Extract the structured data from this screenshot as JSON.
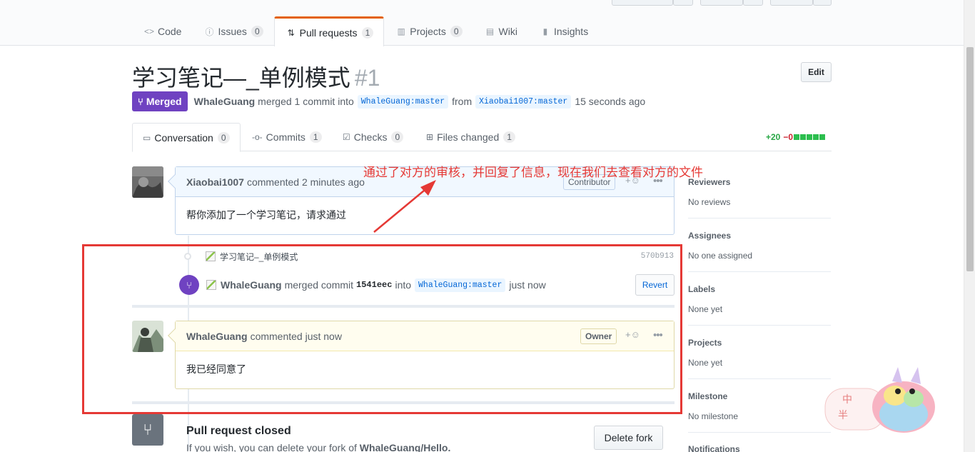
{
  "repo_nav": {
    "tabs": [
      {
        "label": "Code",
        "icon": "code-icon",
        "count": null
      },
      {
        "label": "Issues",
        "icon": "issue-icon",
        "count": "0"
      },
      {
        "label": "Pull requests",
        "icon": "pull-request-icon",
        "count": "1"
      },
      {
        "label": "Projects",
        "icon": "project-icon",
        "count": "0"
      },
      {
        "label": "Wiki",
        "icon": "book-icon",
        "count": null
      },
      {
        "label": "Insights",
        "icon": "graph-icon",
        "count": null
      }
    ]
  },
  "pr": {
    "title": "学习笔记—_单例模式",
    "number": "#1",
    "edit_label": "Edit",
    "state_label": "Merged",
    "author": "WhaleGuang",
    "meta_text": "merged 1 commit into",
    "base_branch": "WhaleGuang:master",
    "from_text": "from",
    "head_branch": "Xiaobai1007:master",
    "time": "15 seconds ago"
  },
  "tabs": [
    {
      "label": "Conversation",
      "count": "0"
    },
    {
      "label": "Commits",
      "count": "1"
    },
    {
      "label": "Checks",
      "count": "0"
    },
    {
      "label": "Files changed",
      "count": "1"
    }
  ],
  "diffstat": {
    "add": "+20",
    "del": "−0"
  },
  "comment1": {
    "author": "Xiaobai1007",
    "action": "commented 2 minutes ago",
    "role": "Contributor",
    "body": "帮你添加了一个学习笔记，请求通过"
  },
  "commit": {
    "message": "学习笔记–_单例模式",
    "sha": "570b913"
  },
  "merge_event": {
    "actor": "WhaleGuang",
    "text": "merged commit",
    "sha": "1541eec",
    "into": "into",
    "branch": "WhaleGuang:master",
    "time": "just now",
    "revert_label": "Revert"
  },
  "comment2": {
    "author": "WhaleGuang",
    "action": "commented just now",
    "role": "Owner",
    "body": "我已经同意了"
  },
  "closed": {
    "title": "Pull request closed",
    "sub_prefix": "If you wish, you can delete your fork of",
    "repo": "WhaleGuang/Hello.",
    "button": "Delete fork"
  },
  "sidebar": [
    {
      "heading": "Reviewers",
      "value": "No reviews"
    },
    {
      "heading": "Assignees",
      "value": "No one assigned"
    },
    {
      "heading": "Labels",
      "value": "None yet"
    },
    {
      "heading": "Projects",
      "value": "None yet"
    },
    {
      "heading": "Milestone",
      "value": "No milestone"
    },
    {
      "heading": "Notifications",
      "value": ""
    }
  ],
  "annotation": "通过了对方的审核，并回复了信息，现在我们去查看对方的文件",
  "colors": {
    "merged": "#6f42c1",
    "annotation": "#e53935",
    "accent_tab": "#e36209"
  }
}
